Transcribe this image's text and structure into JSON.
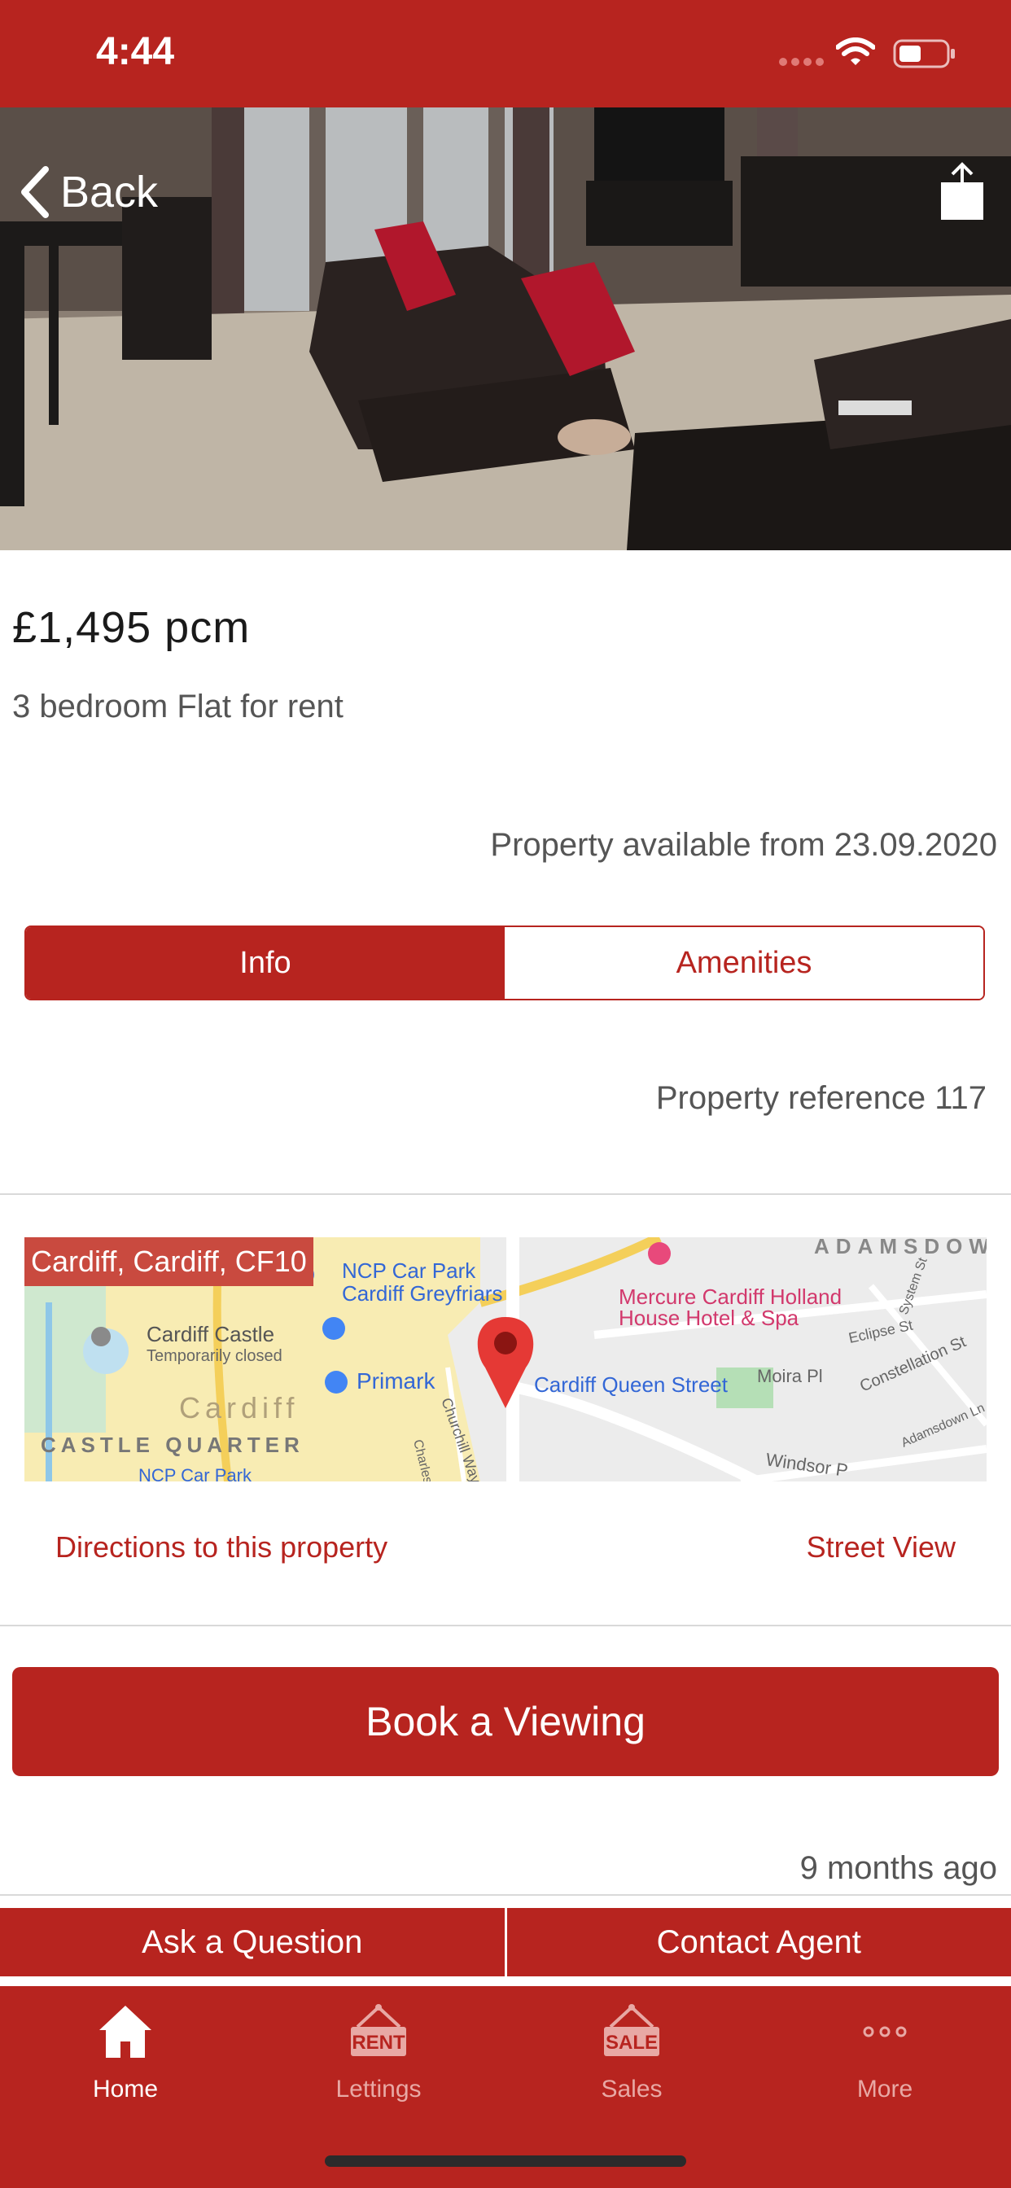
{
  "status": {
    "time": "4:44"
  },
  "header": {
    "back_label": "Back"
  },
  "listing": {
    "price": "£1,495 pcm",
    "type": "3 bedroom Flat for rent",
    "available": "Property available from 23.09.2020",
    "reference": "Property reference 117",
    "posted": "9 months ago"
  },
  "tabs": [
    {
      "label": "Info",
      "active": true
    },
    {
      "label": "Amenities",
      "active": false
    }
  ],
  "map": {
    "address": "Cardiff, Cardiff, CF10",
    "places": {
      "ncp": "NCP Car Park",
      "ncp2": "Cardiff Greyfriars",
      "castle": "Cardiff Castle",
      "castle_note": "Temporarily closed",
      "mercure": "Mercure Cardiff Holland",
      "mercure2": "House Hotel & Spa",
      "primark": "Primark",
      "station": "Cardiff Queen Street",
      "cardiff": "Cardiff",
      "castle_quarter": "CASTLE QUARTER",
      "adamsdown": "ADAMSDOW",
      "ncp_bottom": "NCP Car Park",
      "moira": "Moira Pl",
      "constellation": "Constellation St",
      "eclipse": "Eclipse St",
      "system": "System St",
      "windsor": "Windsor P",
      "adamsdown_ln": "Adamsdown Ln",
      "churchill": "Churchill Way",
      "charles": "Charles"
    },
    "directions_label": "Directions to this property",
    "street_view_label": "Street View"
  },
  "book_label": "Book a Viewing",
  "actions": {
    "ask": "Ask a Question",
    "contact": "Contact Agent"
  },
  "nav": [
    {
      "label": "Home",
      "icon": "home-icon",
      "active": true
    },
    {
      "label": "Lettings",
      "icon": "rent-sign-icon",
      "sign": "RENT",
      "active": false
    },
    {
      "label": "Sales",
      "icon": "sale-sign-icon",
      "sign": "SALE",
      "active": false
    },
    {
      "label": "More",
      "icon": "more-dots-icon",
      "active": false
    }
  ],
  "colors": {
    "brand": "#b7241f",
    "text_muted": "#555555"
  }
}
